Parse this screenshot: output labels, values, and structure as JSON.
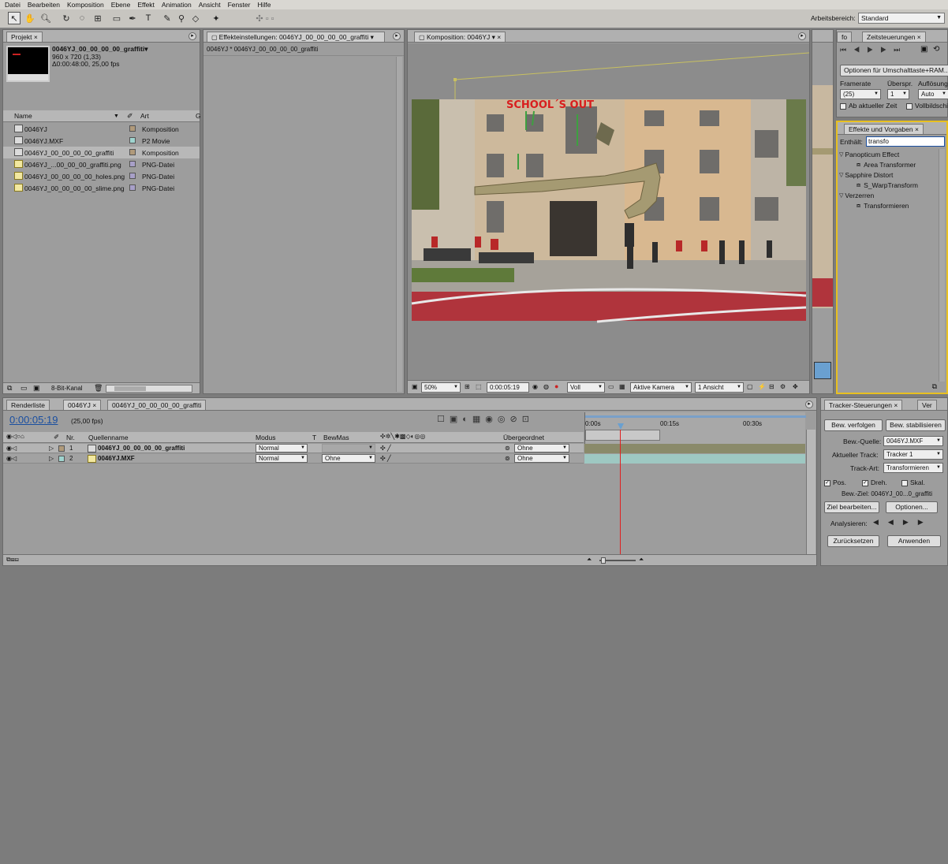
{
  "menu": [
    "Datei",
    "Bearbeiten",
    "Komposition",
    "Ebene",
    "Effekt",
    "Animation",
    "Ansicht",
    "Fenster",
    "Hilfe"
  ],
  "workspace": {
    "label": "Arbeitsbereich:",
    "value": "Standard"
  },
  "project": {
    "tab": "Projekt",
    "item_name": "0046YJ_00_00_00_00_graffiti▾",
    "item_dims": "960 x 720 (1,33)",
    "item_duration": "Δ0:00:48:00, 25,00 fps",
    "col_name": "Name",
    "col_type": "Art",
    "col_extra": "G",
    "items": [
      {
        "name": "0046YJ",
        "type": "Komposition",
        "swatch": "#b09a7a",
        "icon": "comp"
      },
      {
        "name": "0046YJ.MXF",
        "type": "P2 Movie",
        "swatch": "#9fd4cf",
        "icon": "mxf"
      },
      {
        "name": "0046YJ_00_00_00_00_graffiti",
        "type": "Komposition",
        "swatch": "#b09a7a",
        "icon": "comp"
      },
      {
        "name": "0046YJ_...00_00_00_graffiti.png",
        "type": "PNG-Datei",
        "swatch": "#a8a0c8",
        "icon": "png"
      },
      {
        "name": "0046YJ_00_00_00_00_holes.png",
        "type": "PNG-Datei",
        "swatch": "#a8a0c8",
        "icon": "png"
      },
      {
        "name": "0046YJ_00_00_00_00_slime.png",
        "type": "PNG-Datei",
        "swatch": "#a8a0c8",
        "icon": "png"
      }
    ],
    "bit_depth": "8-Bit-Kanal"
  },
  "effect_controls": {
    "tab": "Effekteinstellungen: 0046YJ_00_00_00_00_graffiti",
    "subtitle": "0046YJ * 0046YJ_00_00_00_00_graffiti"
  },
  "composition": {
    "tab": "Komposition: 0046YJ",
    "graffiti_text": "SCHOOL´S OUT",
    "zoom": "50%",
    "timecode": "0:00:05:19",
    "resolution": "Voll",
    "camera": "Aktive Kamera",
    "views": "1 Ansicht"
  },
  "time_controls": {
    "tab_short": "fo",
    "tab": "Zeitsteuerungen",
    "options_button": "Optionen für Umschalttaste+RAM...",
    "framerate_label": "Framerate",
    "skip_label": "Überspr.",
    "resolution_label": "Auflösung",
    "framerate_value": "(25)",
    "skip_value": "1",
    "resolution_value": "Auto",
    "current_time_check": "Ab aktueller Zeit",
    "fullscreen_check": "Vollbildschirm"
  },
  "effects_presets": {
    "tab": "Effekte und Vorgaben",
    "search_label": "Enthält:",
    "search_value": "transfo",
    "groups": [
      {
        "name": "Panopticum Effect",
        "items": [
          "Area Transformer"
        ]
      },
      {
        "name": "Sapphire Distort",
        "items": [
          "S_WarpTransform"
        ]
      },
      {
        "name": "Verzerren",
        "items": [
          "Transformieren"
        ]
      }
    ]
  },
  "timeline": {
    "tabs": [
      "Renderliste",
      "0046YJ",
      "0046YJ_00_00_00_00_graffiti"
    ],
    "timecode": "0:00:05:19",
    "fps": "(25,00 fps)",
    "col_nr": "Nr.",
    "col_source": "Quellenname",
    "col_mode": "Modus",
    "col_t": "T",
    "col_trkmat": "BewMas",
    "col_parent": "Übergeordnet",
    "ruler": [
      "0:00s",
      "00:15s",
      "00:30s"
    ],
    "layers": [
      {
        "nr": "1",
        "name": "0046YJ_00_00_00_00_graffiti",
        "mode": "Normal",
        "trkmat": "",
        "parent": "Ohne"
      },
      {
        "nr": "2",
        "name": "0046YJ.MXF",
        "mode": "Normal",
        "trkmat": "Ohne",
        "parent": "Ohne"
      }
    ]
  },
  "tracker": {
    "tab": "Tracker-Steuerungen",
    "tab2": "Ver",
    "track_motion": "Bew. verfolgen",
    "stabilize": "Bew. stabilisieren",
    "source_label": "Bew.-Quelle:",
    "source_value": "0046YJ.MXF",
    "current_track_label": "Aktueller Track:",
    "current_track_value": "Tracker 1",
    "track_type_label": "Track-Art:",
    "track_type_value": "Transformieren",
    "pos": "Pos.",
    "rot": "Dreh.",
    "scale": "Skal.",
    "target": "Bew.-Ziel: 0046YJ_00...0_graffiti",
    "edit_target": "Ziel bearbeiten...",
    "options": "Optionen...",
    "analyze_label": "Analysieren:",
    "reset": "Zurücksetzen",
    "apply": "Anwenden"
  },
  "colors": {
    "accent": "#1a4fa0",
    "panel": "#9d9d9d",
    "highlight_border": "#e8c020",
    "timeline_cti": "#e02020"
  }
}
